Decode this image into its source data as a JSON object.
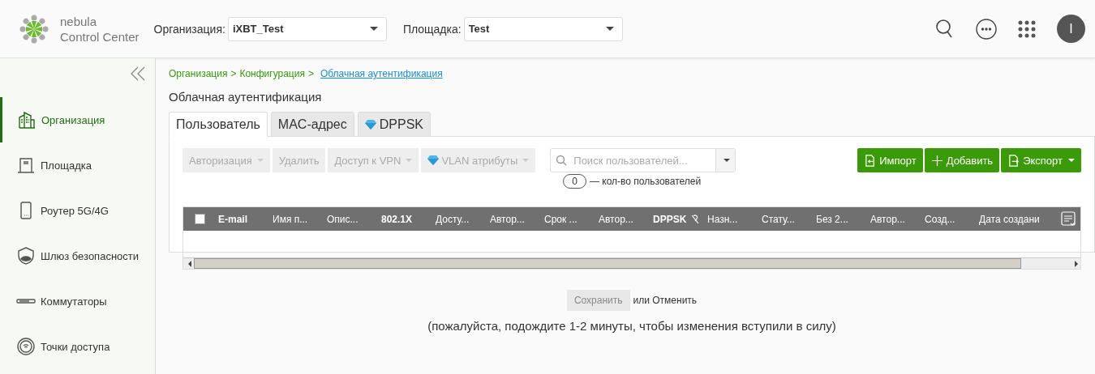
{
  "header": {
    "logo_line1": "nebula",
    "logo_line2": "Control Center",
    "org_label": "Организация:",
    "org_value": "iXBT_Test",
    "site_label": "Площадка:",
    "site_value": "Test",
    "avatar": "I"
  },
  "sidebar": {
    "items": [
      {
        "label": "Организация",
        "kind": "building",
        "selected": true
      },
      {
        "label": "Площадка",
        "kind": "site",
        "selected": false
      },
      {
        "label": "Роутер 5G/4G",
        "kind": "phone",
        "selected": false
      },
      {
        "label": "Шлюз безопасности",
        "kind": "shield",
        "selected": false
      },
      {
        "label": "Коммутаторы",
        "kind": "switch",
        "selected": false
      },
      {
        "label": "Точки доступа",
        "kind": "ap",
        "selected": false
      }
    ]
  },
  "breadcrumb": [
    "Организация",
    "Конфигурация"
  ],
  "breadcrumb_separator": ">",
  "breadcrumb_current": "Облачная аутентификация",
  "page_title": "Облачная аутентификация",
  "tabs": [
    {
      "label": "Пользователь",
      "selected": true,
      "gem": false
    },
    {
      "label": "MAC-адрес",
      "selected": false,
      "gem": false
    },
    {
      "label": "DPPSK",
      "selected": false,
      "gem": true
    }
  ],
  "toolbar": [
    {
      "label": "Авторизация",
      "dropdown": true,
      "gem": false,
      "disabled": true
    },
    {
      "label": "Удалить",
      "dropdown": false,
      "gem": false,
      "disabled": true
    },
    {
      "label": "Доступ к VPN",
      "dropdown": true,
      "gem": false,
      "disabled": true
    },
    {
      "label": "VLAN атрибуты",
      "dropdown": true,
      "gem": true,
      "disabled": true
    }
  ],
  "search": {
    "placeholder": "Поиск пользователей..."
  },
  "count": {
    "value": "0",
    "label": "— кол-во пользователей"
  },
  "actions": [
    {
      "label": "Импорт",
      "kind": "import",
      "dropdown": false
    },
    {
      "label": "Добавить",
      "kind": "plus",
      "dropdown": false
    },
    {
      "label": "Экспорт",
      "kind": "export",
      "dropdown": true
    }
  ],
  "table": {
    "select_all": false,
    "columns": [
      {
        "label": "E-mail",
        "bold": true
      },
      {
        "label": "Имя п...",
        "bold": false
      },
      {
        "label": "Опис...",
        "bold": false
      },
      {
        "label": "802.1X",
        "bold": true
      },
      {
        "label": "Досту...",
        "bold": false
      },
      {
        "label": "Автор...",
        "bold": false
      },
      {
        "label": "Срок ...",
        "bold": false
      },
      {
        "label": "Автор...",
        "bold": false
      },
      {
        "label": "DPPSK",
        "bold": true,
        "icon": true
      },
      {
        "label": "Назн...",
        "bold": false
      },
      {
        "label": "Стату...",
        "bold": false
      },
      {
        "label": "Без 2...",
        "bold": false
      },
      {
        "label": "Автор...",
        "bold": false
      },
      {
        "label": "Созд...",
        "bold": false
      },
      {
        "label": "Дата создани",
        "bold": false
      }
    ]
  },
  "footer": {
    "save": "Сохранить",
    "save_disabled": true,
    "or_cancel": "или Отменить",
    "note": "(пожалуйста, подождите 1-2 минуты, чтобы изменения вступили в силу)"
  }
}
